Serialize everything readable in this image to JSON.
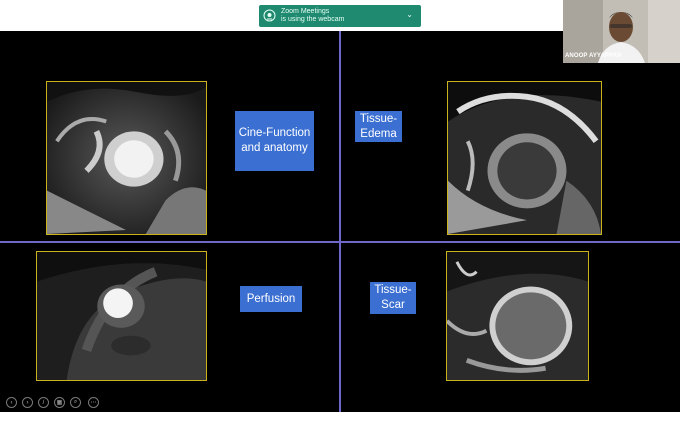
{
  "labels": {
    "cine": "Cine-Function and anatomy",
    "edema": "Tissue-Edema",
    "perfusion": "Perfusion",
    "scar": "Tissue-Scar"
  },
  "notification": {
    "line1": "Zoom Meetings",
    "line2": "is using the webcam",
    "icon": "webcam-icon"
  },
  "webcam": {
    "participant_name": "ANOOP AYYAPPAN"
  },
  "presenter_controls": [
    {
      "name": "previous-icon",
      "glyph": "‹"
    },
    {
      "name": "next-icon",
      "glyph": "›"
    },
    {
      "name": "pen-icon",
      "glyph": "/"
    },
    {
      "name": "slides-icon",
      "glyph": "▦"
    },
    {
      "name": "zoom-icon",
      "glyph": "⌕"
    },
    {
      "name": "more-icon",
      "glyph": "⋯"
    }
  ],
  "colors": {
    "divider": "#6f68c9",
    "label_bg": "#3b6fd1",
    "image_border": "#c9b21a",
    "notification_bg": "#1f8a70"
  }
}
